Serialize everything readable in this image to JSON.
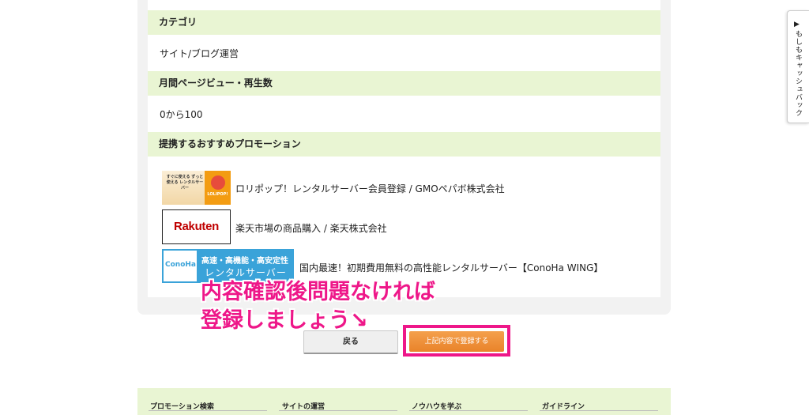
{
  "detail": {
    "category_label": "カテゴリ",
    "category_value": "サイト/ブログ運営",
    "pageviews_label": "月間ページビュー・再生数",
    "pageviews_value": "0から100",
    "promotions_label": "提携するおすすめプロモーション"
  },
  "promotions": [
    {
      "name": "ロリポップ！レンタルサーバー会員登録 / GMOペパボ株式会社",
      "thumb_text": "すぐに使える ずっと使える レンタルサーバー",
      "thumb_logo": "LOLIPOP!"
    },
    {
      "name": "楽天市場の商品購入 / 楽天株式会社",
      "thumb_logo": "Rakuten"
    },
    {
      "name": "国内最速！初期費用無料の高性能レンタルサーバー【ConoHa WING】",
      "thumb_logo": "ConoHa",
      "thumb_line1": "高速・高機能・高安定性",
      "thumb_line2": "レンタルサーバー"
    }
  ],
  "annotation": {
    "line1": "内容確認後問題なければ",
    "line2": "登録しましょう↘"
  },
  "buttons": {
    "back": "戻る",
    "register": "上記内容で登録する"
  },
  "footer": {
    "items": [
      "プロモーション検索",
      "サイトの運営",
      "ノウハウを学ぶ",
      "ガイドライン"
    ]
  },
  "side_tab": {
    "arrow": "▶",
    "label": "もしもキャッシュバック"
  },
  "colors": {
    "accent_pink": "#ee1789",
    "section_green": "#e9f5d3",
    "register_orange": "#ee8e36"
  }
}
